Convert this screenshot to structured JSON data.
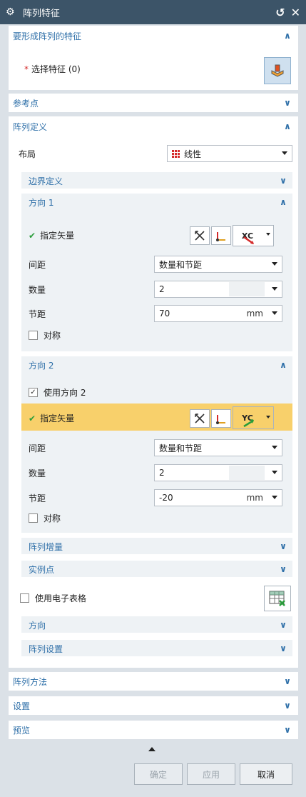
{
  "dialog": {
    "title": "阵列特征",
    "reset_icon": "reset-icon",
    "close_icon": "close-icon"
  },
  "feature_section": {
    "title": "要形成阵列的特征",
    "select_label": "选择特征 (0)"
  },
  "reference_section": {
    "title": "参考点"
  },
  "array_def": {
    "title": "阵列定义",
    "layout_label": "布局",
    "layout_value": "线性",
    "boundary_title": "边界定义",
    "direction1": {
      "title": "方向 1",
      "vector_label": "指定矢量",
      "vector_axis": "XC",
      "spacing_label": "间距",
      "spacing_value": "数量和节距",
      "count_label": "数量",
      "count_value": "2",
      "pitch_label": "节距",
      "pitch_value": "70",
      "pitch_unit": "mm",
      "symmetric_label": "对称"
    },
    "direction2": {
      "title": "方向 2",
      "use_label": "使用方向 2",
      "vector_label": "指定矢量",
      "vector_axis": "YC",
      "spacing_label": "间距",
      "spacing_value": "数量和节距",
      "count_label": "数量",
      "count_value": "2",
      "pitch_label": "节距",
      "pitch_value": "-20",
      "pitch_unit": "mm",
      "symmetric_label": "对称"
    },
    "increment_title": "阵列增量",
    "instance_title": "实例点",
    "spreadsheet_label": "使用电子表格",
    "orientation_title": "方向",
    "settings_title": "阵列设置"
  },
  "method_section": {
    "title": "阵列方法"
  },
  "settings_section": {
    "title": "设置"
  },
  "preview_section": {
    "title": "预览"
  },
  "buttons": {
    "ok": "确定",
    "apply": "应用",
    "cancel": "取消"
  },
  "colors": {
    "titlebar": "#3c5468",
    "accent_blue": "#2e6fa8",
    "highlight": "#f8d06b",
    "check_green": "#2a9d3a",
    "required_red": "#d42a2a"
  }
}
